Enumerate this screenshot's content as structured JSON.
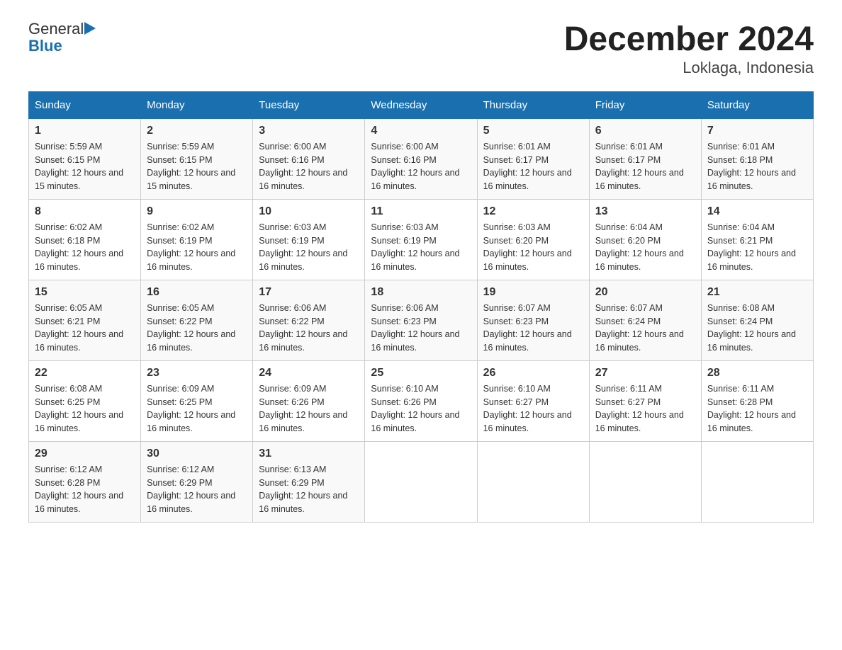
{
  "header": {
    "logo_general": "General",
    "logo_blue": "Blue",
    "title": "December 2024",
    "subtitle": "Loklaga, Indonesia"
  },
  "days_of_week": [
    "Sunday",
    "Monday",
    "Tuesday",
    "Wednesday",
    "Thursday",
    "Friday",
    "Saturday"
  ],
  "weeks": [
    [
      {
        "day": "1",
        "sunrise": "5:59 AM",
        "sunset": "6:15 PM",
        "daylight": "12 hours and 15 minutes."
      },
      {
        "day": "2",
        "sunrise": "5:59 AM",
        "sunset": "6:15 PM",
        "daylight": "12 hours and 15 minutes."
      },
      {
        "day": "3",
        "sunrise": "6:00 AM",
        "sunset": "6:16 PM",
        "daylight": "12 hours and 16 minutes."
      },
      {
        "day": "4",
        "sunrise": "6:00 AM",
        "sunset": "6:16 PM",
        "daylight": "12 hours and 16 minutes."
      },
      {
        "day": "5",
        "sunrise": "6:01 AM",
        "sunset": "6:17 PM",
        "daylight": "12 hours and 16 minutes."
      },
      {
        "day": "6",
        "sunrise": "6:01 AM",
        "sunset": "6:17 PM",
        "daylight": "12 hours and 16 minutes."
      },
      {
        "day": "7",
        "sunrise": "6:01 AM",
        "sunset": "6:18 PM",
        "daylight": "12 hours and 16 minutes."
      }
    ],
    [
      {
        "day": "8",
        "sunrise": "6:02 AM",
        "sunset": "6:18 PM",
        "daylight": "12 hours and 16 minutes."
      },
      {
        "day": "9",
        "sunrise": "6:02 AM",
        "sunset": "6:19 PM",
        "daylight": "12 hours and 16 minutes."
      },
      {
        "day": "10",
        "sunrise": "6:03 AM",
        "sunset": "6:19 PM",
        "daylight": "12 hours and 16 minutes."
      },
      {
        "day": "11",
        "sunrise": "6:03 AM",
        "sunset": "6:19 PM",
        "daylight": "12 hours and 16 minutes."
      },
      {
        "day": "12",
        "sunrise": "6:03 AM",
        "sunset": "6:20 PM",
        "daylight": "12 hours and 16 minutes."
      },
      {
        "day": "13",
        "sunrise": "6:04 AM",
        "sunset": "6:20 PM",
        "daylight": "12 hours and 16 minutes."
      },
      {
        "day": "14",
        "sunrise": "6:04 AM",
        "sunset": "6:21 PM",
        "daylight": "12 hours and 16 minutes."
      }
    ],
    [
      {
        "day": "15",
        "sunrise": "6:05 AM",
        "sunset": "6:21 PM",
        "daylight": "12 hours and 16 minutes."
      },
      {
        "day": "16",
        "sunrise": "6:05 AM",
        "sunset": "6:22 PM",
        "daylight": "12 hours and 16 minutes."
      },
      {
        "day": "17",
        "sunrise": "6:06 AM",
        "sunset": "6:22 PM",
        "daylight": "12 hours and 16 minutes."
      },
      {
        "day": "18",
        "sunrise": "6:06 AM",
        "sunset": "6:23 PM",
        "daylight": "12 hours and 16 minutes."
      },
      {
        "day": "19",
        "sunrise": "6:07 AM",
        "sunset": "6:23 PM",
        "daylight": "12 hours and 16 minutes."
      },
      {
        "day": "20",
        "sunrise": "6:07 AM",
        "sunset": "6:24 PM",
        "daylight": "12 hours and 16 minutes."
      },
      {
        "day": "21",
        "sunrise": "6:08 AM",
        "sunset": "6:24 PM",
        "daylight": "12 hours and 16 minutes."
      }
    ],
    [
      {
        "day": "22",
        "sunrise": "6:08 AM",
        "sunset": "6:25 PM",
        "daylight": "12 hours and 16 minutes."
      },
      {
        "day": "23",
        "sunrise": "6:09 AM",
        "sunset": "6:25 PM",
        "daylight": "12 hours and 16 minutes."
      },
      {
        "day": "24",
        "sunrise": "6:09 AM",
        "sunset": "6:26 PM",
        "daylight": "12 hours and 16 minutes."
      },
      {
        "day": "25",
        "sunrise": "6:10 AM",
        "sunset": "6:26 PM",
        "daylight": "12 hours and 16 minutes."
      },
      {
        "day": "26",
        "sunrise": "6:10 AM",
        "sunset": "6:27 PM",
        "daylight": "12 hours and 16 minutes."
      },
      {
        "day": "27",
        "sunrise": "6:11 AM",
        "sunset": "6:27 PM",
        "daylight": "12 hours and 16 minutes."
      },
      {
        "day": "28",
        "sunrise": "6:11 AM",
        "sunset": "6:28 PM",
        "daylight": "12 hours and 16 minutes."
      }
    ],
    [
      {
        "day": "29",
        "sunrise": "6:12 AM",
        "sunset": "6:28 PM",
        "daylight": "12 hours and 16 minutes."
      },
      {
        "day": "30",
        "sunrise": "6:12 AM",
        "sunset": "6:29 PM",
        "daylight": "12 hours and 16 minutes."
      },
      {
        "day": "31",
        "sunrise": "6:13 AM",
        "sunset": "6:29 PM",
        "daylight": "12 hours and 16 minutes."
      },
      null,
      null,
      null,
      null
    ]
  ],
  "labels": {
    "sunrise_prefix": "Sunrise: ",
    "sunset_prefix": "Sunset: ",
    "daylight_prefix": "Daylight: "
  }
}
